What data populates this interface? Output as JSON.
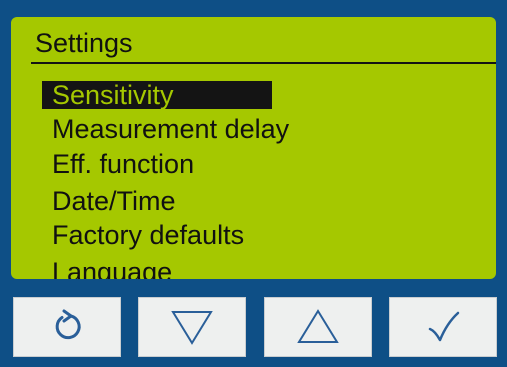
{
  "screen": {
    "title": "Settings",
    "menu": [
      {
        "label": "Sensitivity",
        "selected": true
      },
      {
        "label": "Measurement delay",
        "selected": false
      },
      {
        "label": "Eff. function",
        "selected": false
      },
      {
        "label": "Date/Time",
        "selected": false
      },
      {
        "label": "Factory defaults",
        "selected": false
      },
      {
        "label": "Language",
        "selected": false
      }
    ]
  },
  "buttons": [
    {
      "icon": "back-rotate-icon"
    },
    {
      "icon": "down-triangle-icon"
    },
    {
      "icon": "up-triangle-icon"
    },
    {
      "icon": "checkmark-icon"
    }
  ],
  "colors": {
    "bezel": "#0e4f86",
    "lcd": "#a5c800",
    "lcd_text": "#141414",
    "button_face": "#eef0ef",
    "icon": "#2a5f99"
  }
}
